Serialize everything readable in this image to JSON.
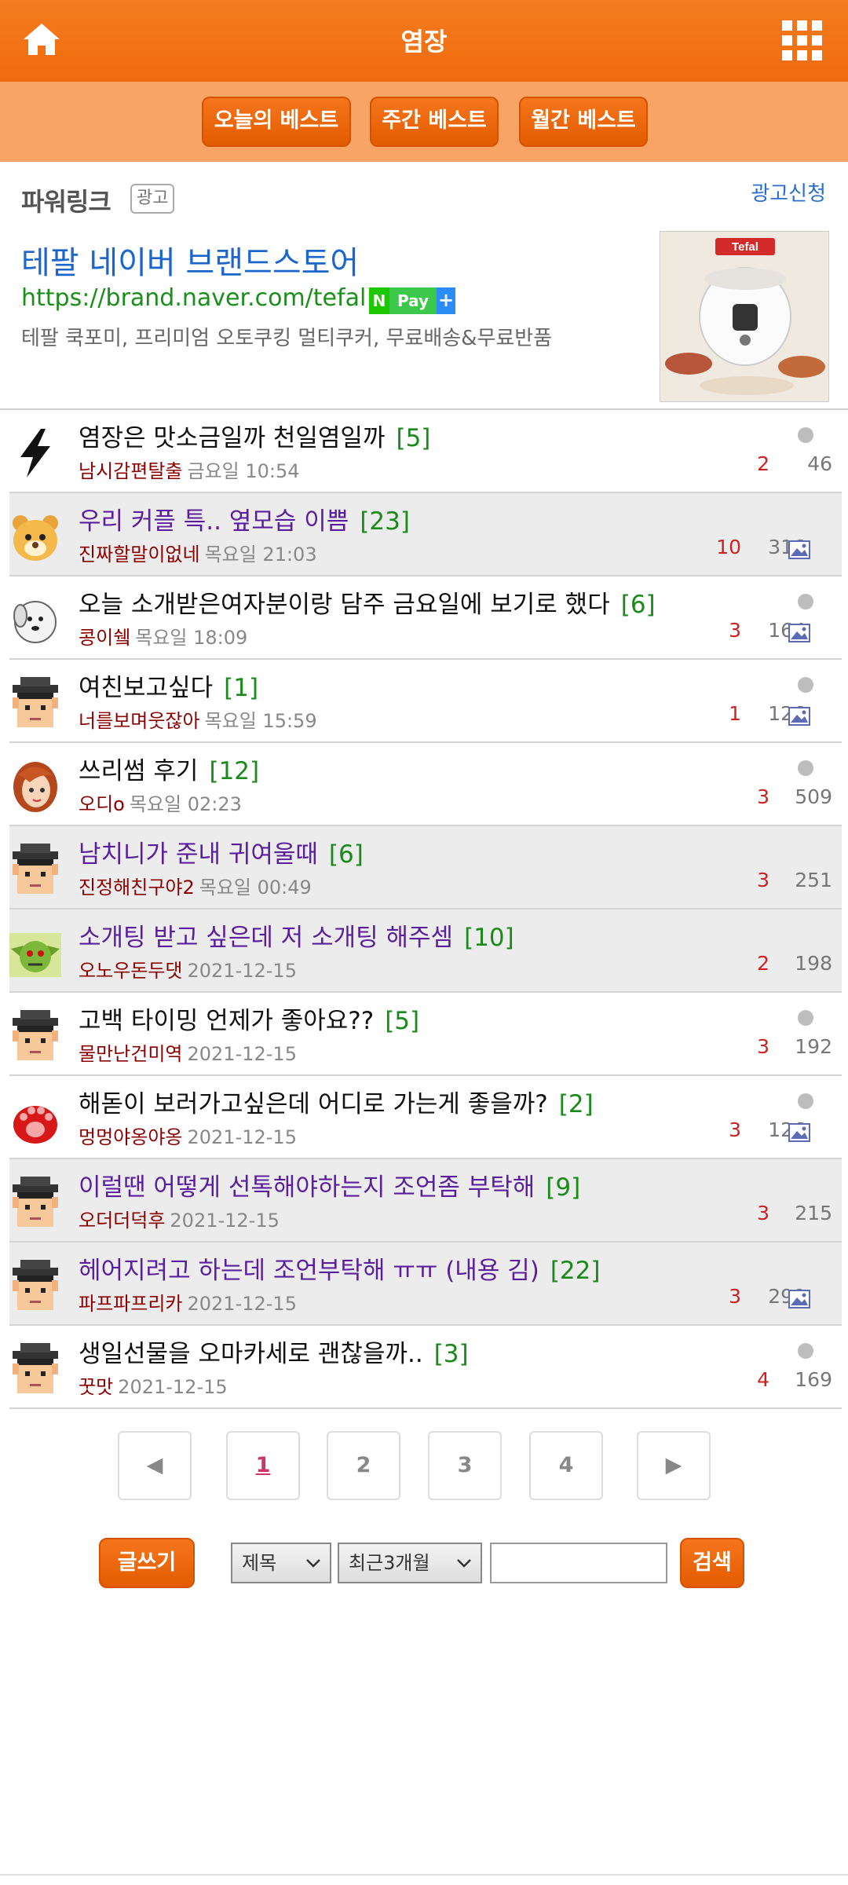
{
  "header": {
    "title": "염장"
  },
  "best_tabs": [
    "오늘의 베스트",
    "주간 베스트",
    "월간 베스트"
  ],
  "ad": {
    "section_label": "파워링크",
    "badge": "광고",
    "apply_link": "광고신청",
    "title": "테팔 네이버 브랜드스토어",
    "url": "https://brand.naver.com/tefal",
    "npay": {
      "n": "N",
      "pay": "Pay",
      "plus": "+"
    },
    "description": "테팔 쿡포미, 프리미엄 오토쿠킹 멀티쿠커, 무료배송&무료반품",
    "thumb_brand": "Tefal"
  },
  "posts": [
    {
      "title": "염장은 맛소금일까 천일염일까",
      "comments": "[5]",
      "author": "남시감편탈출",
      "date": "금요일 10:54",
      "recs": "2",
      "views": "46",
      "has_image": false,
      "new_dot": true,
      "visited": false,
      "avatar": "lightning-icon"
    },
    {
      "title": "우리 커플 특.. 옆모습 이쁨",
      "comments": "[23]",
      "author": "진짜할말이없네",
      "date": "목요일 21:03",
      "recs": "10",
      "views": "316",
      "has_image": true,
      "new_dot": false,
      "visited": true,
      "avatar": "bear-avatar"
    },
    {
      "title": "오늘 소개받은여자분이랑 담주 금요일에 보기로 했다",
      "comments": "[6]",
      "author": "콩이쉨",
      "date": "목요일 18:09",
      "recs": "3",
      "views": "164",
      "has_image": true,
      "new_dot": true,
      "visited": false,
      "avatar": "dog-avatar"
    },
    {
      "title": "여친보고싶다",
      "comments": "[1]",
      "author": "너를보며웃잖아",
      "date": "목요일 15:59",
      "recs": "1",
      "views": "126",
      "has_image": true,
      "new_dot": true,
      "visited": false,
      "avatar": "graduate-avatar"
    },
    {
      "title": "쓰리썸 후기",
      "comments": "[12]",
      "author": "오디o",
      "date": "목요일 02:23",
      "recs": "3",
      "views": "509",
      "has_image": false,
      "new_dot": true,
      "visited": false,
      "avatar": "girl-avatar"
    },
    {
      "title": "남치니가 준내 귀여울때",
      "comments": "[6]",
      "author": "진정해친구야2",
      "date": "목요일 00:49",
      "recs": "3",
      "views": "251",
      "has_image": false,
      "new_dot": false,
      "visited": true,
      "avatar": "graduate-avatar"
    },
    {
      "title": "소개팅 받고 싶은데 저 소개팅 해주셈",
      "comments": "[10]",
      "author": "오노우돈두댓",
      "date": "2021-12-15",
      "recs": "2",
      "views": "198",
      "has_image": false,
      "new_dot": false,
      "visited": true,
      "avatar": "goblin-avatar"
    },
    {
      "title": "고백 타이밍 언제가 좋아요??",
      "comments": "[5]",
      "author": "물만난건미역",
      "date": "2021-12-15",
      "recs": "3",
      "views": "192",
      "has_image": false,
      "new_dot": true,
      "visited": false,
      "avatar": "graduate-avatar"
    },
    {
      "title": "해돋이 보러가고싶은데 어디로 가는게 좋을까?",
      "comments": "[2]",
      "author": "멍멍야옹야옹",
      "date": "2021-12-15",
      "recs": "3",
      "views": "126",
      "has_image": true,
      "new_dot": true,
      "visited": false,
      "avatar": "paw-avatar"
    },
    {
      "title": "이럴땐 어떻게 선톡해야하는지 조언좀 부탁해",
      "comments": "[9]",
      "author": "오더더덕후",
      "date": "2021-12-15",
      "recs": "3",
      "views": "215",
      "has_image": false,
      "new_dot": false,
      "visited": true,
      "avatar": "graduate-avatar"
    },
    {
      "title": "헤어지려고 하는데 조언부탁해 ㅠㅠ (내용 김)",
      "comments": "[22]",
      "author": "파프파프리카",
      "date": "2021-12-15",
      "recs": "3",
      "views": "290",
      "has_image": true,
      "new_dot": false,
      "visited": true,
      "avatar": "graduate-avatar"
    },
    {
      "title": "생일선물을 오마카세로 괜찮을까..",
      "comments": "[3]",
      "author": "꿋맛",
      "date": "2021-12-15",
      "recs": "4",
      "views": "169",
      "has_image": false,
      "new_dot": true,
      "visited": false,
      "avatar": "graduate-avatar"
    }
  ],
  "pagination": {
    "prev": "◀",
    "pages": [
      "1",
      "2",
      "3",
      "4"
    ],
    "current": "1",
    "next": "▶"
  },
  "search": {
    "write_label": "글쓰기",
    "field_select": "제목",
    "period_select": "최근3개월",
    "query_value": "",
    "search_label": "검색"
  },
  "colors": {
    "brand_orange": "#f07318",
    "visited_title": "#5a1f9c",
    "comment_green": "#1a8a1a",
    "author_red": "#8b0000"
  }
}
